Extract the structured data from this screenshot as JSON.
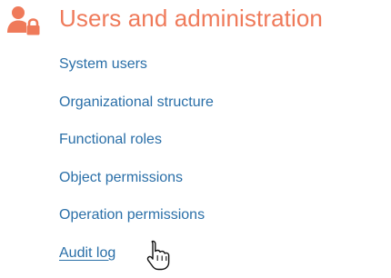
{
  "section": {
    "title": "Users and administration",
    "icon": "user-lock-icon",
    "accent_color": "#ef7a5a",
    "link_color": "#2a6fa8"
  },
  "links": [
    {
      "label": "System users",
      "name": "link-system-users"
    },
    {
      "label": "Organizational structure",
      "name": "link-organizational-structure"
    },
    {
      "label": "Functional roles",
      "name": "link-functional-roles"
    },
    {
      "label": "Object permissions",
      "name": "link-object-permissions"
    },
    {
      "label": "Operation permissions",
      "name": "link-operation-permissions"
    },
    {
      "label": "Audit log",
      "name": "link-audit-log",
      "active": true
    }
  ],
  "cursor": {
    "icon": "hand-pointer-icon"
  }
}
